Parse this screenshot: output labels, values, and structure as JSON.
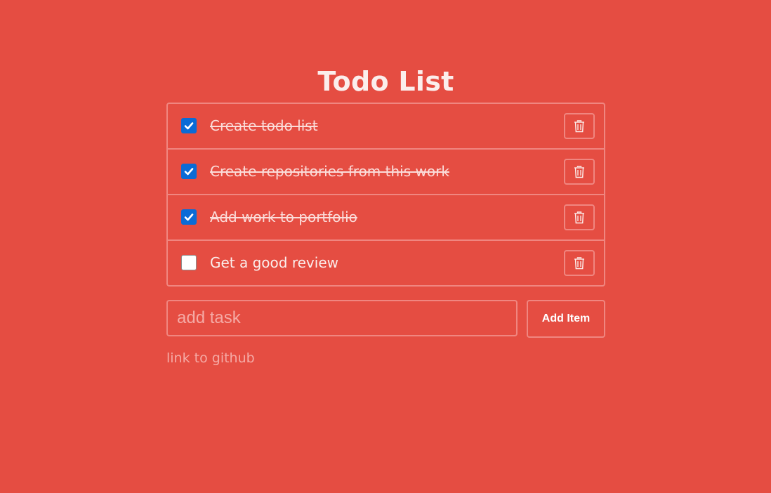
{
  "app": {
    "title": "Todo List"
  },
  "todos": [
    {
      "label": "Create todo list",
      "done": true
    },
    {
      "label": "Create repositories from this work",
      "done": true
    },
    {
      "label": "Add work to portfolio",
      "done": true
    },
    {
      "label": "Get a good review",
      "done": false
    }
  ],
  "add_form": {
    "input_value": "",
    "input_placeholder": "add task",
    "button_label": "Add Item"
  },
  "footer": {
    "link_text": "link to github"
  },
  "colors": {
    "background": "#e54d42",
    "border": "#f08680",
    "checkbox_checked": "#0b6bd6",
    "muted_text": "#f5aaa5"
  },
  "icons": {
    "delete": "trash-icon",
    "checkmark": "check-icon"
  }
}
